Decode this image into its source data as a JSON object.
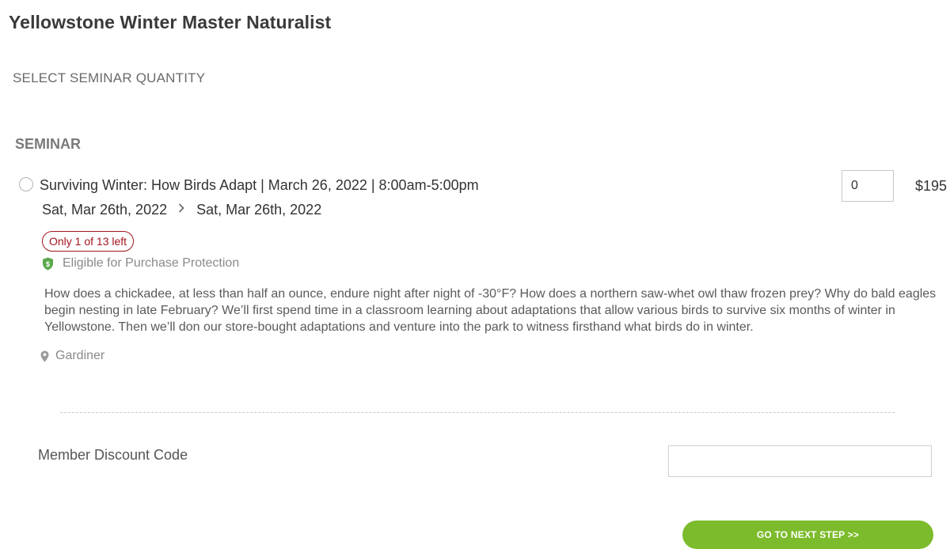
{
  "page": {
    "title": "Yellowstone Winter Master Naturalist",
    "section_heading": "SELECT SEMINAR QUANTITY",
    "category_heading": "SEMINAR"
  },
  "seminar": {
    "title": "Surviving Winter: How Birds Adapt | March 26, 2022 | 8:00am-5:00pm",
    "start_date": "Sat, Mar 26th, 2022",
    "end_date": "Sat, Mar 26th, 2022",
    "quantity": "0",
    "price": "$195",
    "availability_badge": "Only 1 of 13 left",
    "protection_text": "Eligible for Purchase Protection",
    "description": "How does a chickadee, at less than half an ounce, endure night after night of -30°F? How does a northern saw-whet owl thaw frozen prey? Why do bald eagles begin nesting in late February? We’ll first spend time in a classroom learning about adaptations that allow various birds to survive six months of winter in Yellowstone. Then we’ll don our store-bought adaptations and venture into the park to witness firsthand what birds do in winter.",
    "location": "Gardiner"
  },
  "discount": {
    "label": "Member Discount Code",
    "value": ""
  },
  "actions": {
    "next_step_label": "GO TO NEXT STEP >>"
  },
  "colors": {
    "accent_green": "#7cbb2b",
    "badge_red": "#a3151e",
    "shield_green": "#5aa84a"
  },
  "icons": {
    "date_separator": "chevron-right-icon",
    "protection": "shield-dollar-icon",
    "location": "map-pin-icon"
  }
}
